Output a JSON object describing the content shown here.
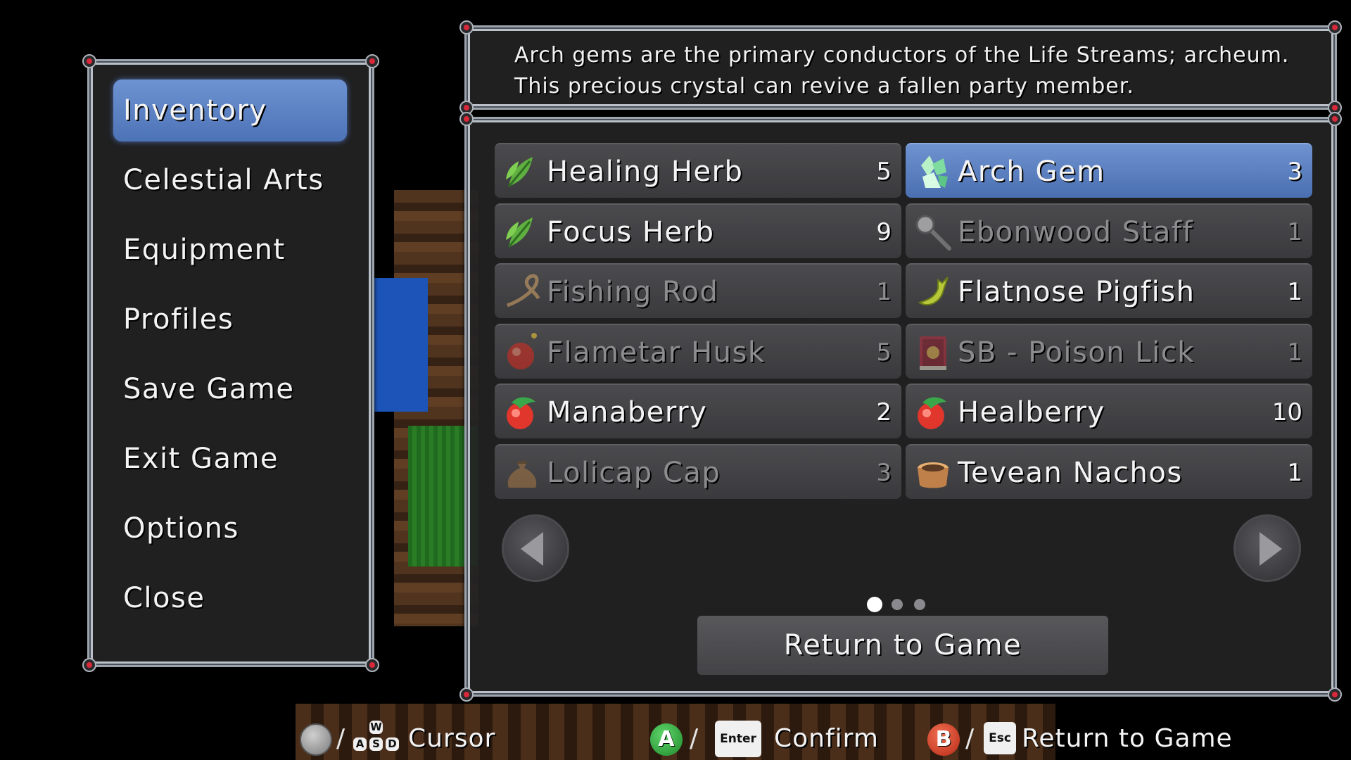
{
  "menu": {
    "items": [
      {
        "label": "Inventory"
      },
      {
        "label": "Celestial Arts"
      },
      {
        "label": "Equipment"
      },
      {
        "label": "Profiles"
      },
      {
        "label": "Save Game"
      },
      {
        "label": "Exit Game"
      },
      {
        "label": "Options"
      },
      {
        "label": "Close"
      }
    ],
    "selected_index": 0
  },
  "description": "Arch gems are the primary conductors of the Life Streams; archeum. This precious crystal can revive a fallen party member.",
  "inventory": {
    "items": [
      {
        "name": "Healing Herb",
        "qty": "5",
        "icon": "leaf-icon",
        "enabled": true
      },
      {
        "name": "Arch Gem",
        "qty": "3",
        "icon": "crystal-icon",
        "enabled": true,
        "selected": true
      },
      {
        "name": "Focus Herb",
        "qty": "9",
        "icon": "leaf-icon",
        "enabled": true
      },
      {
        "name": "Ebonwood Staff",
        "qty": "1",
        "icon": "staff-icon",
        "enabled": false
      },
      {
        "name": "Fishing Rod",
        "qty": "1",
        "icon": "fishing-rod-icon",
        "enabled": false
      },
      {
        "name": "Flatnose Pigfish",
        "qty": "1",
        "icon": "fish-icon",
        "enabled": true
      },
      {
        "name": "Flametar Husk",
        "qty": "5",
        "icon": "bomb-icon",
        "enabled": false
      },
      {
        "name": "SB - Poison Lick",
        "qty": "1",
        "icon": "book-icon",
        "enabled": false
      },
      {
        "name": "Manaberry",
        "qty": "2",
        "icon": "berry-icon",
        "enabled": true
      },
      {
        "name": "Healberry",
        "qty": "10",
        "icon": "berry-icon",
        "enabled": true
      },
      {
        "name": "Lolicap Cap",
        "qty": "3",
        "icon": "sack-icon",
        "enabled": false
      },
      {
        "name": "Tevean Nachos",
        "qty": "1",
        "icon": "pot-icon",
        "enabled": true
      }
    ],
    "pages": 3,
    "current_page": 1,
    "return_label": "Return to Game"
  },
  "hints": {
    "cursor_label": "Cursor",
    "confirm_label": "Confirm",
    "back_label": "Return to Game",
    "wasd_keys": [
      "W",
      "A",
      "S",
      "D"
    ],
    "enter_key": "Enter",
    "esc_key": "Esc",
    "a_button": "A",
    "b_button": "B",
    "slash": "/"
  },
  "colors": {
    "selection": "#5b7fc2",
    "button_a": "#2fa83a",
    "button_b": "#d8432a",
    "corner_gem": "#d8283a"
  }
}
